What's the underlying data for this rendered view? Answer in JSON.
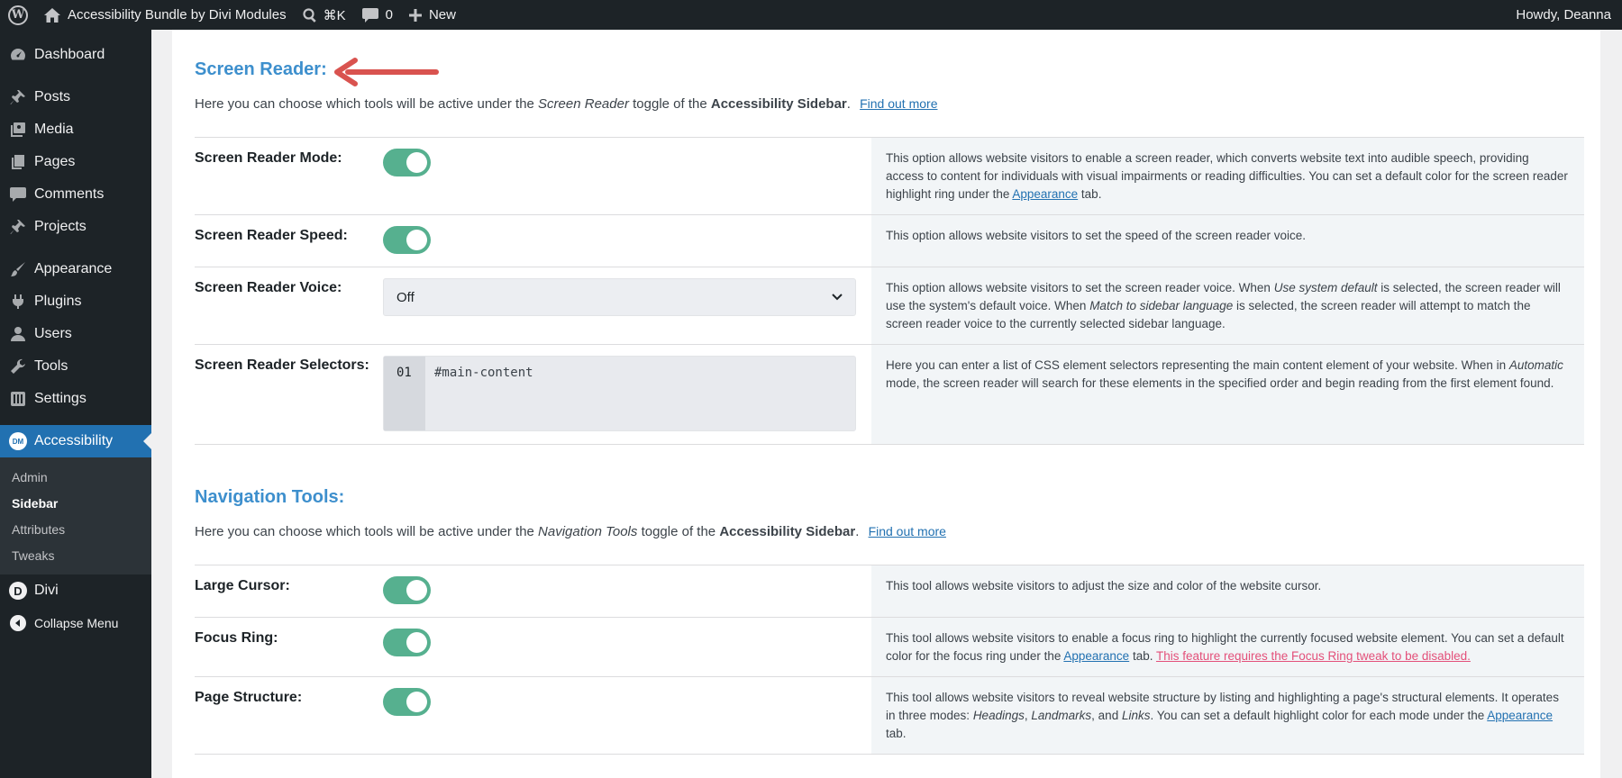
{
  "adminbar": {
    "site_name": "Accessibility Bundle by Divi Modules",
    "search_shortcut": "⌘K",
    "comments_count": "0",
    "new_label": "New",
    "greeting": "Howdy, Deanna"
  },
  "sidebar": {
    "items": [
      {
        "label": "Dashboard",
        "icon": "dashboard-icon"
      },
      {
        "label": "Posts",
        "icon": "pin-icon"
      },
      {
        "label": "Media",
        "icon": "media-icon"
      },
      {
        "label": "Pages",
        "icon": "pages-icon"
      },
      {
        "label": "Comments",
        "icon": "comment-icon"
      },
      {
        "label": "Projects",
        "icon": "pin-icon"
      },
      {
        "label": "Appearance",
        "icon": "brush-icon"
      },
      {
        "label": "Plugins",
        "icon": "plugin-icon"
      },
      {
        "label": "Users",
        "icon": "user-icon"
      },
      {
        "label": "Tools",
        "icon": "wrench-icon"
      },
      {
        "label": "Settings",
        "icon": "settings-icon"
      },
      {
        "label": "Accessibility",
        "icon": "dm-icon",
        "badge": "DM"
      }
    ],
    "submenu": [
      "Admin",
      "Sidebar",
      "Attributes",
      "Tweaks"
    ],
    "divi_label": "Divi",
    "divi_badge": "D",
    "collapse_label": "Collapse Menu"
  },
  "screen_reader": {
    "title": "Screen Reader:",
    "desc_pre": "Here you can choose which tools will be active under the ",
    "desc_em": "Screen Reader",
    "desc_mid": " toggle of the ",
    "desc_bold": "Accessibility Sidebar",
    "desc_post": ".",
    "link": "Find out more",
    "rows": {
      "mode": {
        "label": "Screen Reader Mode:",
        "desc_pre": "This option allows website visitors to enable a screen reader, which converts website text into audible speech, providing access to content for individuals with visual impairments or reading difficulties. You can set a default color for the screen reader highlight ring under the ",
        "desc_link": "Appearance",
        "desc_post": " tab."
      },
      "speed": {
        "label": "Screen Reader Speed:",
        "desc": "This option allows website visitors to set the speed of the screen reader voice."
      },
      "voice": {
        "label": "Screen Reader Voice:",
        "select_value": "Off",
        "desc_1": "This option allows website visitors to set the screen reader voice. When ",
        "desc_em1": "Use system default",
        "desc_2": " is selected, the screen reader will use the system's default voice. When ",
        "desc_em2": "Match to sidebar language",
        "desc_3": " is selected, the screen reader will attempt to match the screen reader voice to the currently selected sidebar language."
      },
      "selectors": {
        "label": "Screen Reader Selectors:",
        "line_number": "01",
        "code": "#main-content",
        "desc_1": "Here you can enter a list of CSS element selectors representing the main content element of your website. When in ",
        "desc_em": "Automatic",
        "desc_2": " mode, the screen reader will search for these elements in the specified order and begin reading from the first element found."
      }
    }
  },
  "navigation_tools": {
    "title": "Navigation Tools:",
    "desc_pre": "Here you can choose which tools will be active under the ",
    "desc_em": "Navigation Tools",
    "desc_mid": " toggle of the ",
    "desc_bold": "Accessibility Sidebar",
    "desc_post": ".",
    "link": "Find out more",
    "rows": {
      "cursor": {
        "label": "Large Cursor:",
        "desc": "This tool allows website visitors to adjust the size and color of the website cursor."
      },
      "focus": {
        "label": "Focus Ring:",
        "desc_pre": "This tool allows website visitors to enable a focus ring to highlight the currently focused website element. You can set a default color for the focus ring under the ",
        "desc_link": "Appearance",
        "desc_mid": " tab. ",
        "warning": "This feature requires the Focus Ring tweak to be disabled."
      },
      "structure": {
        "label": "Page Structure:",
        "desc_1": "This tool allows website visitors to reveal website structure by listing and highlighting a page's structural elements. It operates in three modes: ",
        "em_1": "Headings",
        "sep_1": ", ",
        "em_2": "Landmarks",
        "sep_2": ", and ",
        "em_3": "Links",
        "desc_2": ". You can set a default highlight color for each mode under the ",
        "desc_link": "Appearance",
        "desc_3": " tab."
      }
    }
  },
  "colors": {
    "accent_blue": "#3d8fcd",
    "toggle_on": "#56b08f",
    "annotation_arrow": "#d9534f",
    "warning_link": "#e3507a"
  }
}
